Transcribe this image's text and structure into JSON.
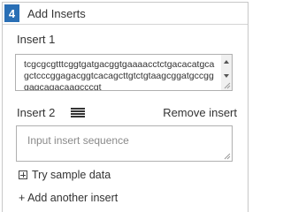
{
  "panel": {
    "step_number": "4",
    "title": "Add Inserts"
  },
  "insert1": {
    "label": "Insert 1",
    "sequence": "tcgcgcgtttcggtgatgacggtgaaaacctctgacacatgcagctcccggagacggtcacagcttgtctgtaagcggatgccgggagcagacaagcccgt"
  },
  "insert2": {
    "label": "Insert 2",
    "remove_label": "Remove insert",
    "placeholder": "Input insert sequence",
    "value": ""
  },
  "actions": {
    "sample_label": "Try sample data",
    "add_label": "+ Add another insert"
  },
  "colors": {
    "step_badge": "#2a6fb5",
    "border": "#c8c8c8",
    "placeholder": "#8a8a8a"
  },
  "icons": {
    "drag": "drag-handle-icon",
    "sample": "plus-square-icon"
  }
}
